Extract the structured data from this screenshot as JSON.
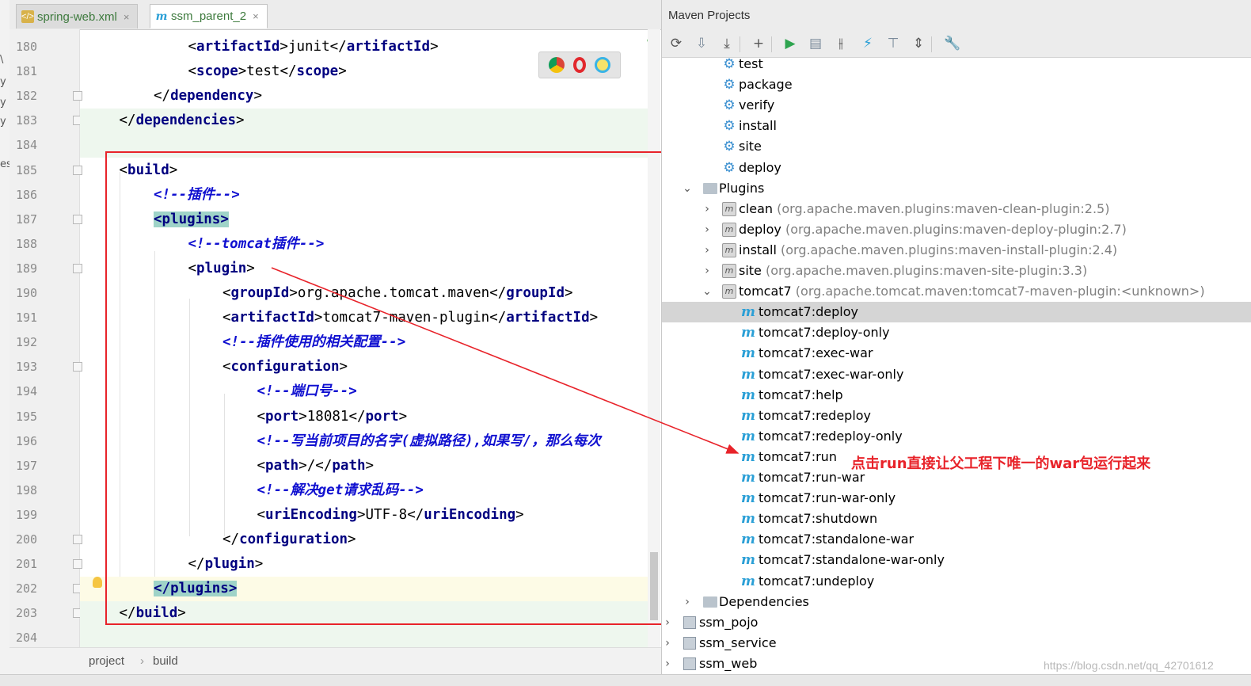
{
  "left_strip": [
    "\\",
    "y",
    "y",
    "y",
    "es"
  ],
  "tabs": [
    {
      "label": "spring-web.xml",
      "close": "×",
      "icon": "xml-file-icon"
    },
    {
      "label": "ssm_parent_2",
      "close": "×",
      "icon": "maven-m-icon"
    }
  ],
  "editor": {
    "line_numbers": [
      "180",
      "181",
      "182",
      "183",
      "184",
      "185",
      "186",
      "187",
      "188",
      "189",
      "190",
      "191",
      "192",
      "193",
      "194",
      "195",
      "196",
      "197",
      "198",
      "199",
      "200",
      "201",
      "202",
      "203",
      "204"
    ],
    "lines": [
      {
        "indent": 3,
        "parts": [
          [
            "br",
            "<"
          ],
          [
            "tg",
            "artifactId"
          ],
          [
            "br",
            ">"
          ],
          [
            "tx",
            "junit"
          ],
          [
            "br",
            "</"
          ],
          [
            "tg",
            "artifactId"
          ],
          [
            "br",
            ">"
          ]
        ]
      },
      {
        "indent": 3,
        "parts": [
          [
            "br",
            "<"
          ],
          [
            "tg",
            "scope"
          ],
          [
            "br",
            ">"
          ],
          [
            "tx",
            "test"
          ],
          [
            "br",
            "</"
          ],
          [
            "tg",
            "scope"
          ],
          [
            "br",
            ">"
          ]
        ]
      },
      {
        "indent": 2,
        "parts": [
          [
            "br",
            "</"
          ],
          [
            "tg",
            "dependency"
          ],
          [
            "br",
            ">"
          ]
        ]
      },
      {
        "indent": 1,
        "parts": [
          [
            "br",
            "</"
          ],
          [
            "tg",
            "dependencies"
          ],
          [
            "br",
            ">"
          ]
        ]
      },
      {
        "indent": 0,
        "parts": []
      },
      {
        "indent": 1,
        "parts": [
          [
            "br",
            "<"
          ],
          [
            "tg",
            "build"
          ],
          [
            "br",
            ">"
          ]
        ]
      },
      {
        "indent": 2,
        "parts": [
          [
            "cm",
            "<!--插件-->"
          ]
        ]
      },
      {
        "indent": 2,
        "parts": [
          [
            "tgh",
            "<"
          ],
          [
            "tgh",
            "plugins"
          ],
          [
            "tgh",
            ">"
          ]
        ]
      },
      {
        "indent": 3,
        "parts": [
          [
            "cm",
            "<!--tomcat插件-->"
          ]
        ]
      },
      {
        "indent": 3,
        "parts": [
          [
            "br",
            "<"
          ],
          [
            "tg",
            "plugin"
          ],
          [
            "br",
            ">"
          ]
        ]
      },
      {
        "indent": 4,
        "parts": [
          [
            "br",
            "<"
          ],
          [
            "tg",
            "groupId"
          ],
          [
            "br",
            ">"
          ],
          [
            "tx",
            "org.apache.tomcat.maven"
          ],
          [
            "br",
            "</"
          ],
          [
            "tg",
            "groupId"
          ],
          [
            "br",
            ">"
          ]
        ]
      },
      {
        "indent": 4,
        "parts": [
          [
            "br",
            "<"
          ],
          [
            "tg",
            "artifactId"
          ],
          [
            "br",
            ">"
          ],
          [
            "tx",
            "tomcat7-maven-plugin"
          ],
          [
            "br",
            "</"
          ],
          [
            "tg",
            "artifactId"
          ],
          [
            "br",
            ">"
          ]
        ]
      },
      {
        "indent": 4,
        "parts": [
          [
            "cm",
            "<!--插件使用的相关配置-->"
          ]
        ]
      },
      {
        "indent": 4,
        "parts": [
          [
            "br",
            "<"
          ],
          [
            "tg",
            "configuration"
          ],
          [
            "br",
            ">"
          ]
        ]
      },
      {
        "indent": 5,
        "parts": [
          [
            "cm",
            "<!--端口号-->"
          ]
        ]
      },
      {
        "indent": 5,
        "parts": [
          [
            "br",
            "<"
          ],
          [
            "tg",
            "port"
          ],
          [
            "br",
            ">"
          ],
          [
            "tx",
            "18081"
          ],
          [
            "br",
            "</"
          ],
          [
            "tg",
            "port"
          ],
          [
            "br",
            ">"
          ]
        ]
      },
      {
        "indent": 5,
        "parts": [
          [
            "cm",
            "<!--写当前项目的名字(虚拟路径),如果写/，那么每次"
          ]
        ]
      },
      {
        "indent": 5,
        "parts": [
          [
            "br",
            "<"
          ],
          [
            "tg",
            "path"
          ],
          [
            "br",
            ">"
          ],
          [
            "tx",
            "/"
          ],
          [
            "br",
            "</"
          ],
          [
            "tg",
            "path"
          ],
          [
            "br",
            ">"
          ]
        ]
      },
      {
        "indent": 5,
        "parts": [
          [
            "cm",
            "<!--解决get请求乱码-->"
          ]
        ]
      },
      {
        "indent": 5,
        "parts": [
          [
            "br",
            "<"
          ],
          [
            "tg",
            "uriEncoding"
          ],
          [
            "br",
            ">"
          ],
          [
            "tx",
            "UTF-8"
          ],
          [
            "br",
            "</"
          ],
          [
            "tg",
            "uriEncoding"
          ],
          [
            "br",
            ">"
          ]
        ]
      },
      {
        "indent": 4,
        "parts": [
          [
            "br",
            "</"
          ],
          [
            "tg",
            "configuration"
          ],
          [
            "br",
            ">"
          ]
        ]
      },
      {
        "indent": 3,
        "parts": [
          [
            "br",
            "</"
          ],
          [
            "tg",
            "plugin"
          ],
          [
            "br",
            ">"
          ]
        ]
      },
      {
        "indent": 2,
        "parts": [
          [
            "tgh",
            "</"
          ],
          [
            "tgh",
            "plugins"
          ],
          [
            "tgh",
            ">"
          ]
        ]
      },
      {
        "indent": 1,
        "parts": [
          [
            "br",
            "</"
          ],
          [
            "tg",
            "build"
          ],
          [
            "br",
            ">"
          ]
        ]
      },
      {
        "indent": 0,
        "parts": []
      }
    ]
  },
  "breadcrumb": {
    "items": [
      "project",
      "build"
    ],
    "separator": "›"
  },
  "maven": {
    "title": "Maven Projects",
    "toolbar_icons": [
      "refresh-icon",
      "reimport-folder-icon",
      "download-icon",
      "add-icon",
      "run-icon",
      "execute-goal-icon",
      "toggle-offline-icon",
      "lightning-icon",
      "collapse-icon",
      "expand-icon",
      "settings-wrench-icon"
    ],
    "lifecycle": [
      "test",
      "package",
      "verify",
      "install",
      "site",
      "deploy"
    ],
    "plugins_label": "Plugins",
    "plugins": [
      {
        "name": "clean",
        "coord": "(org.apache.maven.plugins:maven-clean-plugin:2.5)",
        "expanded": false
      },
      {
        "name": "deploy",
        "coord": "(org.apache.maven.plugins:maven-deploy-plugin:2.7)",
        "expanded": false
      },
      {
        "name": "install",
        "coord": "(org.apache.maven.plugins:maven-install-plugin:2.4)",
        "expanded": false
      },
      {
        "name": "site",
        "coord": "(org.apache.maven.plugins:maven-site-plugin:3.3)",
        "expanded": false
      },
      {
        "name": "tomcat7",
        "coord": "(org.apache.tomcat.maven:tomcat7-maven-plugin:<unknown>)",
        "expanded": true
      }
    ],
    "goals": [
      "tomcat7:deploy",
      "tomcat7:deploy-only",
      "tomcat7:exec-war",
      "tomcat7:exec-war-only",
      "tomcat7:help",
      "tomcat7:redeploy",
      "tomcat7:redeploy-only",
      "tomcat7:run",
      "tomcat7:run-war",
      "tomcat7:run-war-only",
      "tomcat7:shutdown",
      "tomcat7:standalone-war",
      "tomcat7:standalone-war-only",
      "tomcat7:undeploy"
    ],
    "selected_goal": "tomcat7:deploy",
    "dependencies_label": "Dependencies",
    "modules": [
      "ssm_pojo",
      "ssm_service",
      "ssm_web"
    ]
  },
  "annotation": "点击run直接让父工程下唯一的war包运行起来",
  "watermark": "https://blog.csdn.net/qq_42701612",
  "colors": {
    "annotation_red": "#e8232a",
    "tag_navy": "#000080",
    "comment_blue": "#1010d0",
    "maven_blue": "#2a9fd6"
  }
}
